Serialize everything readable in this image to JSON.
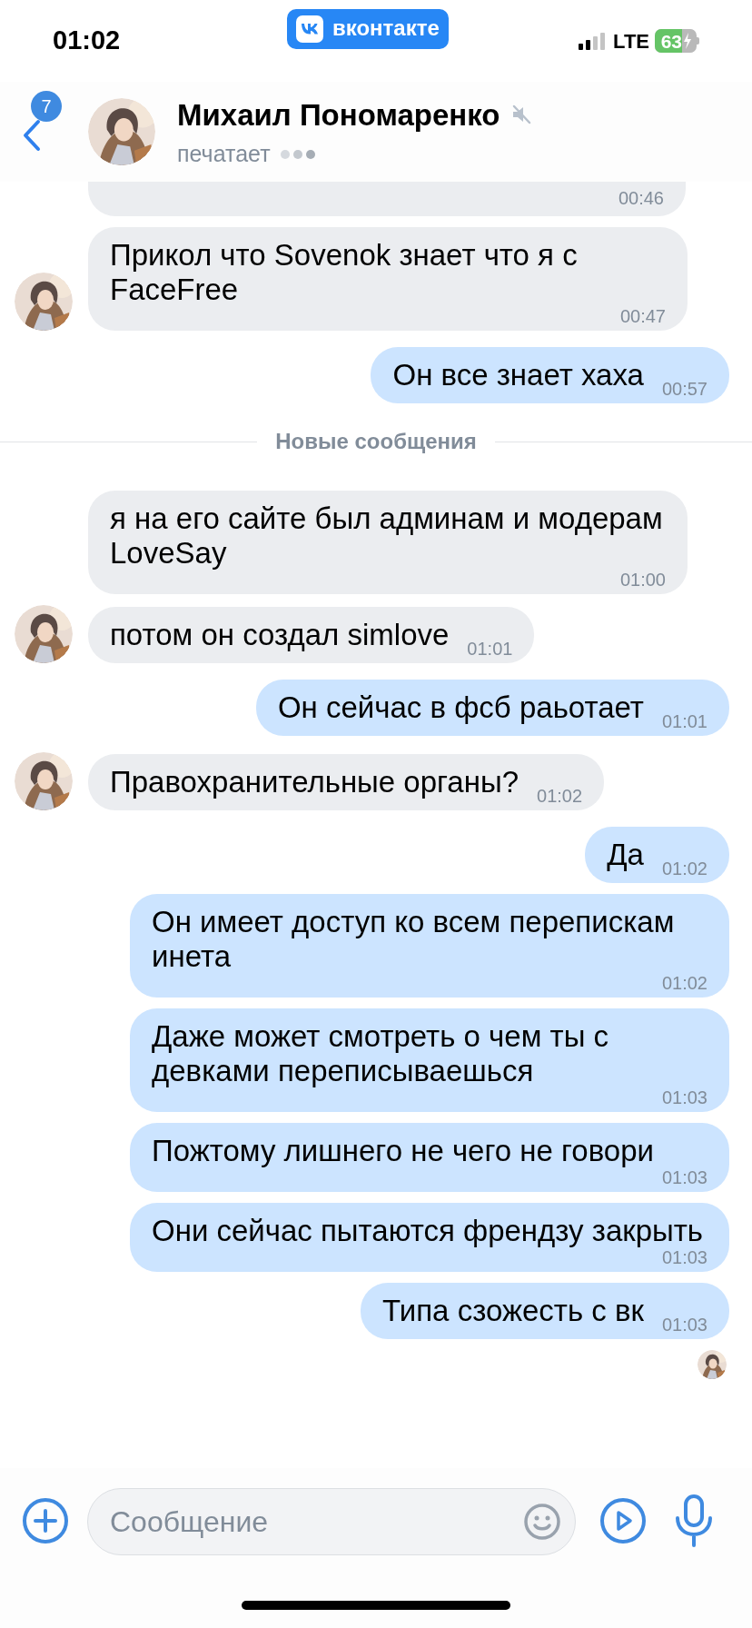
{
  "status_bar": {
    "time": "01:02",
    "app_badge": "вконтакте",
    "network": "LTE",
    "battery": "63"
  },
  "header": {
    "back_count": "7",
    "name": "Михаил Пономаренко",
    "status": "печатает"
  },
  "messages": [
    {
      "kind": "incoming",
      "time": "00:46"
    },
    {
      "kind": "incoming",
      "text": "Прикол что Sovenok знает что я с FaceFree",
      "time": "00:47"
    },
    {
      "kind": "outgoing",
      "text": "Он все знает хаха",
      "time": "00:57"
    },
    {
      "kind": "divider",
      "text": "Новые сообщения"
    },
    {
      "kind": "incoming",
      "text": "я на его сайте был админам и модерам LoveSay",
      "time": "01:00"
    },
    {
      "kind": "incoming",
      "text": "потом он создал simlove",
      "time": "01:01"
    },
    {
      "kind": "outgoing",
      "text": "Он сейчас в фсб раьотает",
      "time": "01:01"
    },
    {
      "kind": "incoming",
      "text": "Правохранительные органы?",
      "time": "01:02"
    },
    {
      "kind": "outgoing",
      "text": "Да",
      "time": "01:02"
    },
    {
      "kind": "outgoing",
      "text": "Он имеет доступ ко всем перепискам инета",
      "time": "01:02"
    },
    {
      "kind": "outgoing",
      "text": "Даже может смотреть о чем ты с девками переписываешься",
      "time": "01:03"
    },
    {
      "kind": "outgoing",
      "text": "Пожтому лишнего не чего не говори",
      "time": "01:03"
    },
    {
      "kind": "outgoing",
      "text": "Они сейчас пытаются френдзу закрыть",
      "time": "01:03"
    },
    {
      "kind": "outgoing",
      "text": "Типа сзожесть с вк",
      "time": "01:03"
    }
  ],
  "composer": {
    "placeholder": "Сообщение"
  }
}
